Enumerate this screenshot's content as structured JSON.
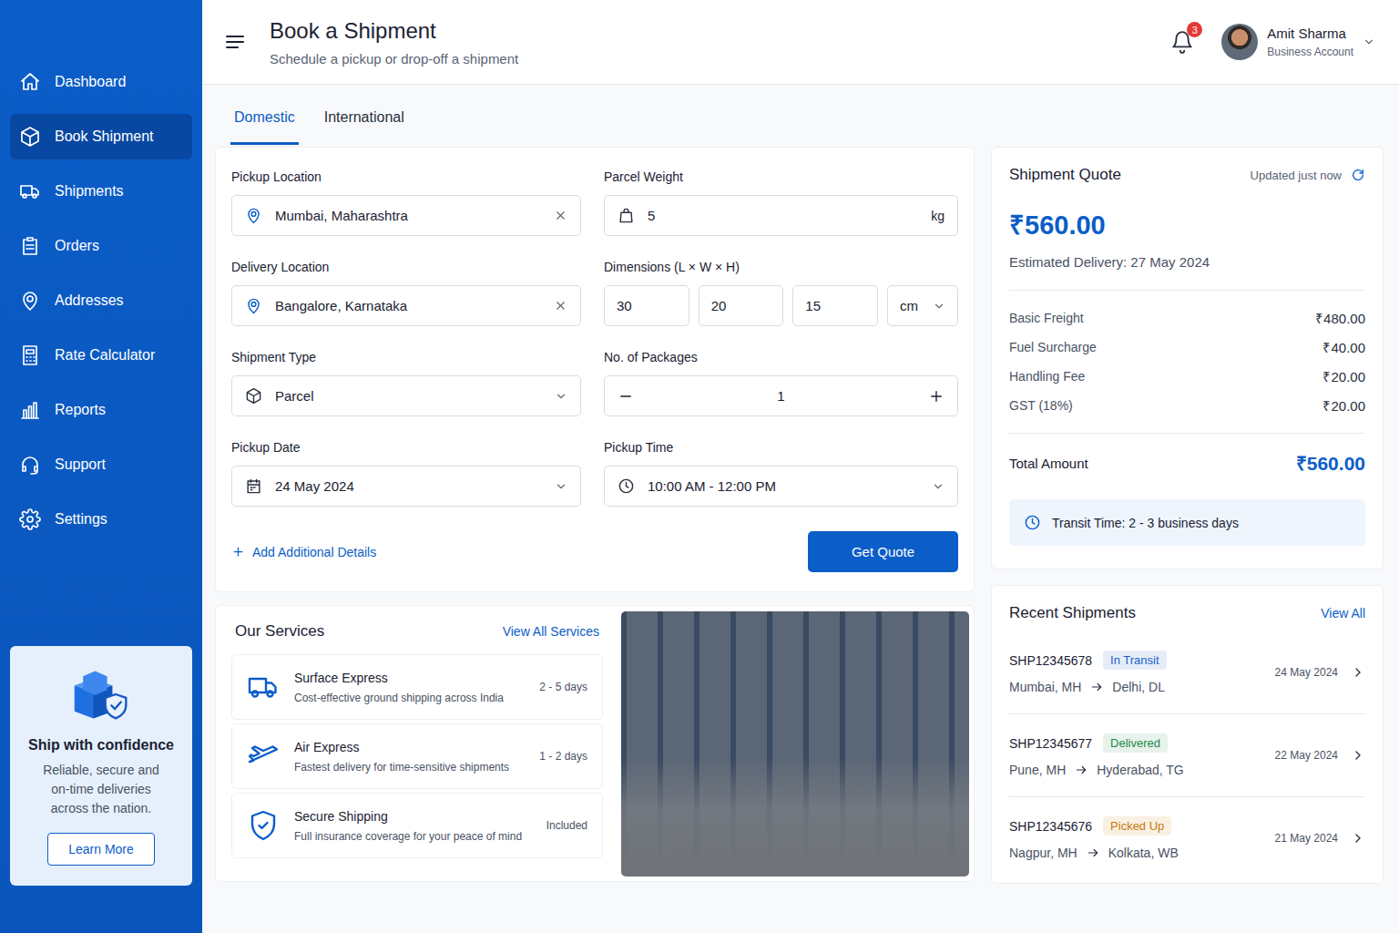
{
  "header": {
    "title": "Book a Shipment",
    "subtitle": "Schedule a pickup or drop-off a shipment",
    "notifications": "3",
    "user": {
      "name": "Amit Sharma",
      "role": "Business Account"
    }
  },
  "sidebar": {
    "items": [
      {
        "label": "Dashboard",
        "selected": false
      },
      {
        "label": "Book Shipment",
        "selected": true
      },
      {
        "label": "Shipments",
        "selected": false
      },
      {
        "label": "Orders",
        "selected": false
      },
      {
        "label": "Addresses",
        "selected": false
      },
      {
        "label": "Rate Calculator",
        "selected": false
      },
      {
        "label": "Reports",
        "selected": false
      },
      {
        "label": "Support",
        "selected": false
      },
      {
        "label": "Settings",
        "selected": false
      }
    ],
    "promo": {
      "title": "Ship with confidence",
      "text": "Reliable, secure and on-time deliveries across the nation.",
      "button": "Learn More"
    }
  },
  "tabs": [
    {
      "label": "Domestic",
      "selected": true
    },
    {
      "label": "International",
      "selected": false
    }
  ],
  "form": {
    "pickup": {
      "label": "Pickup Location",
      "value": "Mumbai, Maharashtra"
    },
    "delivery": {
      "label": "Delivery Location",
      "value": "Bangalore, Karnataka"
    },
    "type": {
      "label": "Shipment Type",
      "value": "Parcel"
    },
    "date": {
      "label": "Pickup Date",
      "value": "24 May 2024"
    },
    "weight": {
      "label": "Parcel Weight",
      "value": "5",
      "unit": "kg"
    },
    "dimensions": {
      "label": "Dimensions (L × W × H)",
      "values": [
        "30",
        "20",
        "15"
      ],
      "unit": "cm"
    },
    "packages": {
      "label": "No. of Packages",
      "value": "1"
    },
    "time": {
      "label": "Pickup Time",
      "value": "10:00 AM - 12:00 PM"
    },
    "add_details": "Add Additional Details",
    "submit": "Get Quote"
  },
  "quote": {
    "title": "Shipment Quote",
    "updated": "Updated just now",
    "amount": "₹560.00",
    "delivery": "Estimated Delivery: 27 May 2024",
    "lines": [
      {
        "label": "Basic Freight",
        "value": "₹480.00"
      },
      {
        "label": "Fuel Surcharge",
        "value": "₹40.00"
      },
      {
        "label": "Handling Fee",
        "value": "₹20.00"
      },
      {
        "label": "GST (18%)",
        "value": "₹20.00"
      }
    ],
    "total": {
      "label": "Total Amount",
      "value": "₹560.00"
    },
    "transit": "Transit Time: 2 - 3 business days"
  },
  "services": {
    "title": "Our Services",
    "link": "View All Services",
    "items": [
      {
        "name": "Surface Express",
        "desc": "Cost-effective ground shipping across India",
        "meta": "2 - 5 days"
      },
      {
        "name": "Air Express",
        "desc": "Fastest delivery for time-sensitive shipments",
        "meta": "1 - 2 days"
      },
      {
        "name": "Secure Shipping",
        "desc": "Full insurance coverage for your peace of mind",
        "meta": "Included"
      }
    ]
  },
  "recent": {
    "title": "Recent Shipments",
    "link": "View All",
    "items": [
      {
        "id": "SHP12345678",
        "status": "In Transit",
        "color": "#1a5fc8",
        "from": "Mumbai, MH",
        "to": "Delhi, DL",
        "date": "24 May 2024"
      },
      {
        "id": "SHP12345677",
        "status": "Delivered",
        "color": "#1f8a47",
        "from": "Pune, MH",
        "to": "Hyderabad, TG",
        "date": "22 May 2024"
      },
      {
        "id": "SHP12345676",
        "status": "Picked Up",
        "color": "#c7780a",
        "from": "Nagpur, MH",
        "to": "Kolkata, WB",
        "date": "21 May 2024"
      }
    ]
  }
}
